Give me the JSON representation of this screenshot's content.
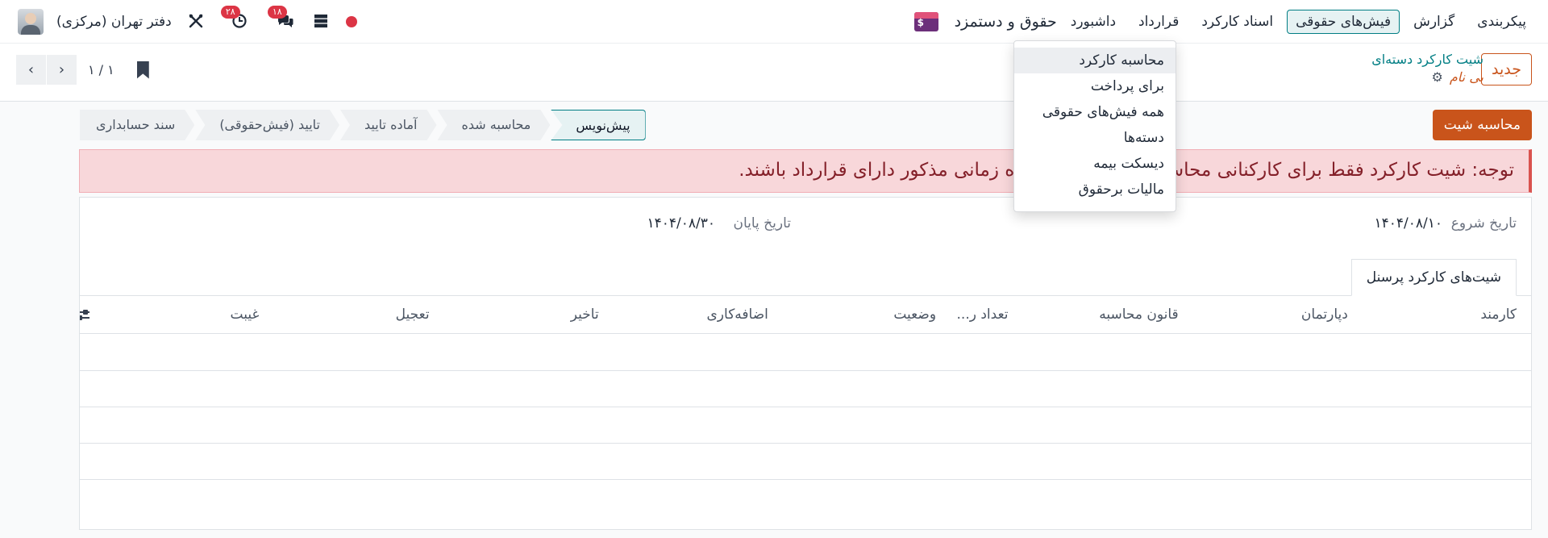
{
  "navbar": {
    "app_name": "حقوق و دستمزد",
    "menu": [
      "داشبورد",
      "قرارداد",
      "اسناد کارکرد",
      "فیش‌های حقوقی",
      "گزارش",
      "پیکربندی"
    ],
    "company": "دفتر تهران (مرکزی)",
    "activity_count": "۲۸",
    "messages_count": "۱۸",
    "icons": [
      "app-icon",
      "tools-icon",
      "clock-icon",
      "chat-icon",
      "database-icon",
      "status-dot",
      "user-avatar"
    ],
    "status_color": "#dc3545"
  },
  "payslip_menu": {
    "items": [
      "محاسبه کارکرد",
      "برای پرداخت",
      "همه فیش‌های حقوقی",
      "دسته‌ها",
      "دیسکت بیمه",
      "مالیات برحقوق"
    ]
  },
  "control": {
    "new_label": "جدید",
    "breadcrumb_parent": "شیت کارکرد دسته‌ای",
    "record_name": "بی نام",
    "pager_value": "۱ / ۱"
  },
  "actions": {
    "compute_label": "محاسبه شیت"
  },
  "statusbar": {
    "stages": [
      "پیش‌نویس",
      "محاسبه شده",
      "آماده تایید",
      "تایید (فیش‌حقوقی)",
      "سند حسابداری"
    ],
    "current": "پیش‌نویس"
  },
  "alert": {
    "text": "توجه: شیت کارکرد فقط برای کارکنانی محاسبه می‌شود که در بازه زمانی مذکور دارای قرارداد باشند."
  },
  "form": {
    "start_date_label": "تاریخ شروع",
    "start_date": "۱۴۰۴/۰۸/۱۰",
    "end_date_label": "تاریخ پایان",
    "end_date": "۱۴۰۴/۰۸/۳۰",
    "tab_label": "شیت‌های کارکرد پرسنل"
  },
  "table": {
    "columns": [
      "کارمند",
      "دپارتمان",
      "قانون محاسبه",
      "تعداد ر...",
      "وضعیت",
      "اضافه‌کاری",
      "تاخیر",
      "تعجیل",
      "غیبت"
    ]
  },
  "colors": {
    "accent": "#c9541b",
    "primary": "#017e84",
    "alert_bg": "#f8d7da"
  }
}
